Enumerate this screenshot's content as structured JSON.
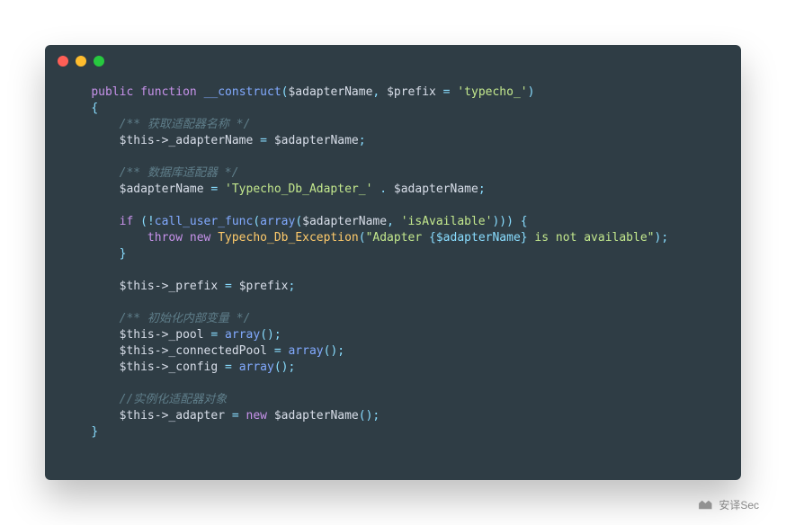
{
  "window": {
    "dots": [
      "red",
      "yellow",
      "green"
    ]
  },
  "code": {
    "i0": "    ",
    "i1": "        ",
    "kw_public": "public",
    "sp": " ",
    "kw_function": "function",
    "fn_name": "__construct",
    "lp": "(",
    "rp": ")",
    "comma": ", ",
    "assign": " = ",
    "semi": ";",
    "lb": "{",
    "rb": "}",
    "var_adapterName": "$adapterName",
    "var_prefix": "$prefix",
    "var_this": "$this",
    "str_typecho": "'typecho_'",
    "c_getAdapter": "/** 获取适配器名称 */",
    "this_adapterName": "->_adapterName",
    "c_dbAdapter": "/** 数据库适配器 */",
    "str_prefixCls": "'Typecho_Db_Adapter_'",
    "concat": " . ",
    "kw_if": "if",
    "sp_lp": " (",
    "bang": "!",
    "fn_cuf": "call_user_func",
    "fn_array": "array",
    "str_isAvailable": "'isAvailable'",
    "rp3": ")))",
    "sp_lb": " {",
    "i2": "            ",
    "kw_throw": "throw",
    "kw_new": "new",
    "cls_ex": "Typecho_Db_Exception",
    "str_ex_1": "\"Adapter ",
    "strint_ex": "{$adapterName}",
    "str_ex_2": " is not available\"",
    "this_prefix": "->_prefix",
    "c_init": "/** 初始化内部变量 */",
    "this_pool": "->_pool",
    "this_connPool": "->_connectedPool",
    "this_config": "->_config",
    "arrcall": "()",
    "c_inst": "//实例化适配器对象",
    "this_adapter": "->_adapter"
  },
  "watermark": {
    "text": "安译Sec"
  }
}
